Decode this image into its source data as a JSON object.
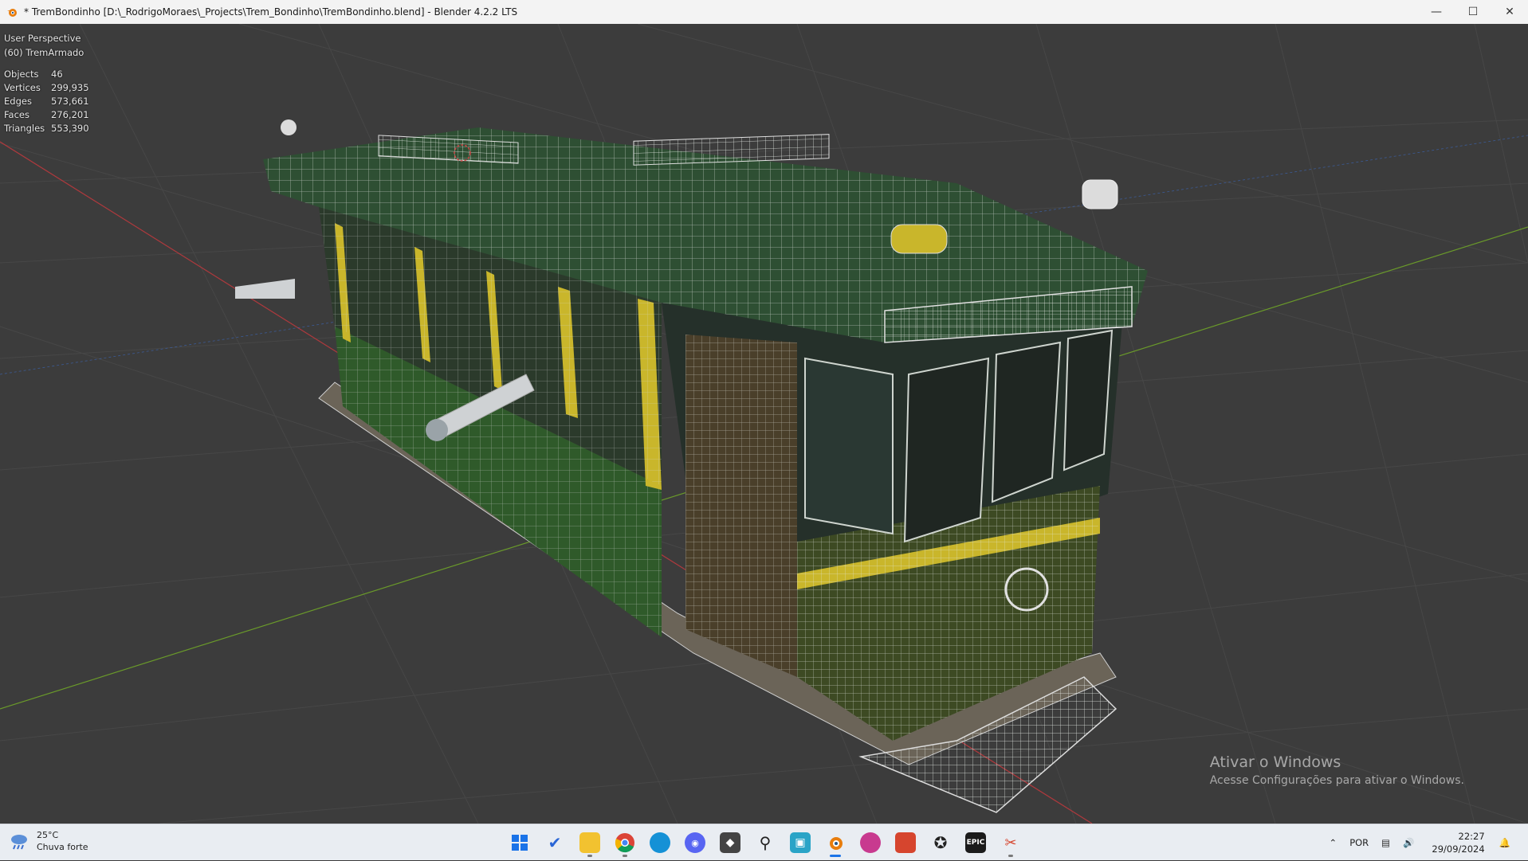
{
  "window": {
    "title": "* TremBondinho [D:\\_RodrigoMoraes\\_Projects\\Trem_Bondinho\\TremBondinho.blend] - Blender 4.2.2 LTS",
    "controls": [
      "minimize-icon",
      "maximize-icon",
      "close-icon"
    ]
  },
  "viewport": {
    "perspective": "User Perspective",
    "active_object": "(60) TremArmado",
    "stats": [
      {
        "label": "Objects",
        "value": "46"
      },
      {
        "label": "Vertices",
        "value": "299,935"
      },
      {
        "label": "Edges",
        "value": "573,661"
      },
      {
        "label": "Faces",
        "value": "276,201"
      },
      {
        "label": "Triangles",
        "value": "553,390"
      }
    ],
    "watermark": {
      "heading": "Ativar o Windows",
      "subtext": "Acesse Configurações para ativar o Windows."
    },
    "colors": {
      "background": "#3c3c3c",
      "x_axis": "#b0393d",
      "y_axis": "#6a9a2a",
      "z_axis": "#3b6fd0"
    }
  },
  "taskbar": {
    "weather": {
      "temperature": "25°C",
      "condition": "Chuva forte"
    },
    "apps": [
      {
        "name": "windows-start-icon"
      },
      {
        "name": "todo-icon"
      },
      {
        "name": "file-explorer-icon"
      },
      {
        "name": "chrome-icon"
      },
      {
        "name": "edge-icon"
      },
      {
        "name": "discord-icon"
      },
      {
        "name": "unity-icon"
      },
      {
        "name": "search-app-icon"
      },
      {
        "name": "teams-icon"
      },
      {
        "name": "blender-icon"
      },
      {
        "name": "davinci-icon"
      },
      {
        "name": "substance-icon"
      },
      {
        "name": "zbrush-icon"
      },
      {
        "name": "epic-games-icon"
      },
      {
        "name": "snipping-tool-icon"
      }
    ],
    "tray": {
      "language": "POR",
      "time": "22:27",
      "date": "29/09/2024"
    }
  }
}
